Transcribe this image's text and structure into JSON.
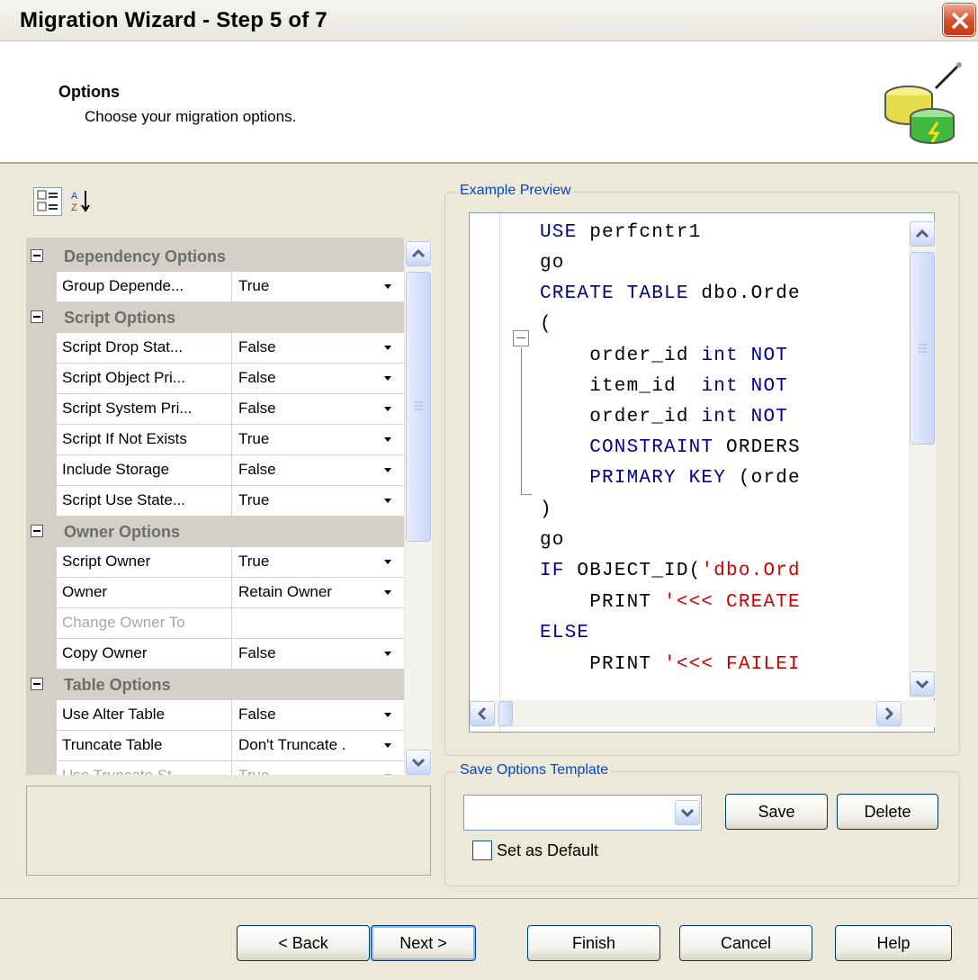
{
  "window": {
    "title": "Migration Wizard - Step 5 of 7"
  },
  "header": {
    "title": "Options",
    "subtitle": "Choose your migration options."
  },
  "property_grid": {
    "categories": [
      {
        "label": "Dependency Options",
        "rows": [
          {
            "name": "Group Depende...",
            "value": "True",
            "dropdown": true,
            "disabled": false
          }
        ]
      },
      {
        "label": "Script Options",
        "rows": [
          {
            "name": "Script Drop Stat...",
            "value": "False",
            "dropdown": true,
            "disabled": false
          },
          {
            "name": "Script Object Pri...",
            "value": "False",
            "dropdown": true,
            "disabled": false
          },
          {
            "name": "Script System Pri...",
            "value": "False",
            "dropdown": true,
            "disabled": false
          },
          {
            "name": "Script If Not Exists",
            "value": "True",
            "dropdown": true,
            "disabled": false
          },
          {
            "name": "Include Storage",
            "value": "False",
            "dropdown": true,
            "disabled": false
          },
          {
            "name": "Script Use State...",
            "value": "True",
            "dropdown": true,
            "disabled": false
          }
        ]
      },
      {
        "label": "Owner Options",
        "rows": [
          {
            "name": "Script Owner",
            "value": "True",
            "dropdown": true,
            "disabled": false
          },
          {
            "name": "Owner",
            "value": "Retain Owner",
            "dropdown": true,
            "disabled": false
          },
          {
            "name": "Change Owner To",
            "value": "",
            "dropdown": false,
            "disabled": true
          },
          {
            "name": "Copy Owner",
            "value": "False",
            "dropdown": true,
            "disabled": false
          }
        ]
      },
      {
        "label": "Table Options",
        "rows": [
          {
            "name": "Use Alter Table",
            "value": "False",
            "dropdown": true,
            "disabled": false
          },
          {
            "name": "Truncate Table",
            "value": "Don't Truncate .",
            "dropdown": true,
            "disabled": false
          },
          {
            "name": "Use Truncate St...",
            "value": "True",
            "dropdown": true,
            "disabled": true
          }
        ]
      }
    ]
  },
  "preview": {
    "label": "Example Preview",
    "lines": [
      [
        [
          "kw",
          "USE"
        ],
        [
          "t",
          " perfcntr1"
        ]
      ],
      [
        [
          "t",
          "go"
        ]
      ],
      [
        [
          "kw",
          "CREATE TABLE"
        ],
        [
          "t",
          " dbo.Orde"
        ]
      ],
      [
        [
          "t",
          "("
        ]
      ],
      [
        [
          "t",
          "    order_id "
        ],
        [
          "kw",
          "int NOT"
        ]
      ],
      [
        [
          "t",
          "    item_id  "
        ],
        [
          "kw",
          "int NOT"
        ]
      ],
      [
        [
          "t",
          "    order_id "
        ],
        [
          "kw",
          "int NOT"
        ]
      ],
      [
        [
          "kw",
          "    CONSTRAINT"
        ],
        [
          "t",
          " ORDERS"
        ]
      ],
      [
        [
          "kw",
          "    PRIMARY KEY"
        ],
        [
          "t",
          " (orde"
        ]
      ],
      [
        [
          "t",
          ")"
        ]
      ],
      [
        [
          "t",
          "go"
        ]
      ],
      [
        [
          "kw",
          "IF"
        ],
        [
          "t",
          " OBJECT_ID("
        ],
        [
          "str",
          "'dbo.Ord"
        ]
      ],
      [
        [
          "t",
          "    PRINT "
        ],
        [
          "str",
          "'<<< CREATE"
        ]
      ],
      [
        [
          "kw",
          "ELSE"
        ]
      ],
      [
        [
          "t",
          "    PRINT "
        ],
        [
          "str",
          "'<<< FAILEI"
        ]
      ]
    ]
  },
  "template": {
    "label": "Save Options Template",
    "combo_value": "",
    "save_label": "Save",
    "delete_label": "Delete",
    "default_label": "Set as Default"
  },
  "footer": {
    "back_label": "< Back",
    "next_label": "Next >",
    "finish_label": "Finish",
    "cancel_label": "Cancel",
    "help_label": "Help"
  }
}
